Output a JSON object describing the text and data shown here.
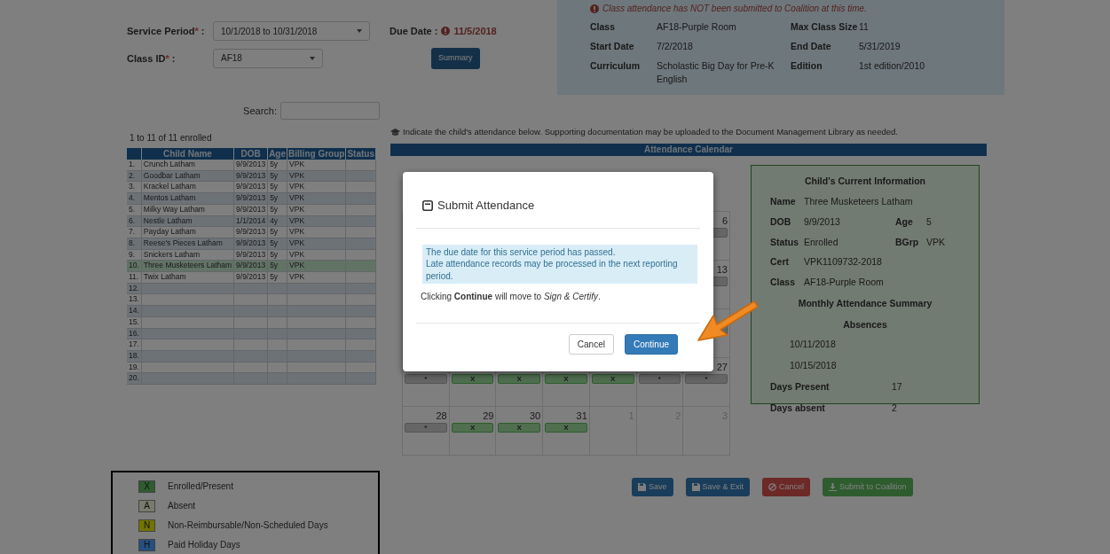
{
  "form": {
    "fields": [
      {
        "label": "Service Period",
        "required_mark": "*",
        "separator": ":",
        "value": "10/1/2018 to 10/31/2018"
      },
      {
        "label": "Class ID",
        "required_mark": "*",
        "separator": ":",
        "value": "AF18"
      }
    ],
    "due_date": {
      "label": "Due Date :",
      "value": "11/5/2018"
    },
    "summary_button": "Summary"
  },
  "class_info": {
    "notice": "Class attendance has NOT been submitted to Coalition at this time.",
    "rows": [
      {
        "label": "Class",
        "value": "AF18-Purple Room",
        "label2": "Max Class Size",
        "value2": "11"
      },
      {
        "label": "Start Date",
        "value": "7/2/2018",
        "label2": "End Date",
        "value2": "5/31/2019"
      },
      {
        "label": "Curriculum",
        "value": "Scholastic Big Day for Pre-K English",
        "label2": "Edition",
        "value2": "1st edition/2010"
      }
    ]
  },
  "search": {
    "label": "Search:"
  },
  "enrolled_count": "1 to 11 of 11 enrolled",
  "table": {
    "columns": [
      "",
      "Child Name",
      "DOB",
      "Age",
      "Billing Group",
      "Status"
    ],
    "rows": [
      {
        "num": "1.",
        "name": "Crunch Latham",
        "dob": "9/9/2013",
        "age": "5y",
        "group": "VPK",
        "selected": false
      },
      {
        "num": "2.",
        "name": "Goodbar Latham",
        "dob": "9/9/2013",
        "age": "5y",
        "group": "VPK",
        "selected": false
      },
      {
        "num": "3.",
        "name": "Krackel Latham",
        "dob": "9/9/2013",
        "age": "5y",
        "group": "VPK",
        "selected": false
      },
      {
        "num": "4.",
        "name": "Mentos Latham",
        "dob": "9/9/2013",
        "age": "5y",
        "group": "VPK",
        "selected": false
      },
      {
        "num": "5.",
        "name": "Milky Way Latham",
        "dob": "9/9/2013",
        "age": "5y",
        "group": "VPK",
        "selected": false
      },
      {
        "num": "6.",
        "name": "Nestle Latham",
        "dob": "1/1/2014",
        "age": "4y",
        "group": "VPK",
        "selected": false
      },
      {
        "num": "7.",
        "name": "Payday Latham",
        "dob": "9/9/2013",
        "age": "5y",
        "group": "VPK",
        "selected": false
      },
      {
        "num": "8.",
        "name": "Reese's Pieces Latham",
        "dob": "9/9/2013",
        "age": "5y",
        "group": "VPK",
        "selected": false
      },
      {
        "num": "9.",
        "name": "Snickers Latham",
        "dob": "9/9/2013",
        "age": "5y",
        "group": "VPK",
        "selected": false
      },
      {
        "num": "10.",
        "name": "Three Musketeers Latham",
        "dob": "9/9/2013",
        "age": "5y",
        "group": "VPK",
        "selected": true
      },
      {
        "num": "11.",
        "name": "Twix Latham",
        "dob": "9/9/2013",
        "age": "5y",
        "group": "VPK",
        "selected": false
      },
      {
        "num": "12.",
        "selected": false
      },
      {
        "num": "13.",
        "selected": false
      },
      {
        "num": "14.",
        "selected": false
      },
      {
        "num": "15.",
        "selected": false
      },
      {
        "num": "16.",
        "selected": false
      },
      {
        "num": "17.",
        "selected": false
      },
      {
        "num": "18.",
        "selected": false
      },
      {
        "num": "19.",
        "selected": false
      },
      {
        "num": "20.",
        "selected": false
      }
    ]
  },
  "instruction": "Indicate the child's attendance below. Supporting documentation may be uploaded to the Document Management Library as needed.",
  "calendar": {
    "title": "Attendance Calendar",
    "weeks": [
      [
        {
          "kind": "blank"
        },
        {
          "kind": "blank"
        },
        {
          "kind": "blank"
        },
        {
          "kind": "blank"
        },
        {
          "kind": "blank"
        },
        {
          "kind": "blank"
        },
        {
          "kind": "weekend",
          "day": "6"
        }
      ],
      [
        {
          "kind": "blank"
        },
        {
          "kind": "blank"
        },
        {
          "kind": "blank"
        },
        {
          "kind": "blank"
        },
        {
          "kind": "blank"
        },
        {
          "kind": "blank"
        },
        {
          "kind": "weekend",
          "day": "13"
        }
      ],
      [
        {
          "kind": "blank"
        },
        {
          "kind": "blank"
        },
        {
          "kind": "blank"
        },
        {
          "kind": "blank"
        },
        {
          "kind": "blank"
        },
        {
          "kind": "blank"
        },
        {
          "kind": "weekend"
        }
      ],
      [
        {
          "kind": "weekend",
          "mark": "*"
        },
        {
          "kind": "present",
          "mark": "X"
        },
        {
          "kind": "present",
          "mark": "X"
        },
        {
          "kind": "present",
          "mark": "X"
        },
        {
          "kind": "present",
          "mark": "X"
        },
        {
          "kind": "weekend",
          "mark": "*"
        },
        {
          "kind": "weekend",
          "day": "27",
          "mark": "*"
        }
      ],
      [
        {
          "kind": "weekend",
          "day": "28",
          "mark": "*"
        },
        {
          "kind": "present",
          "day": "29",
          "mark": "X"
        },
        {
          "kind": "present",
          "day": "30",
          "mark": "X"
        },
        {
          "kind": "present",
          "day": "31",
          "mark": "X"
        },
        {
          "kind": "outside",
          "day": "1"
        },
        {
          "kind": "outside",
          "day": "2"
        },
        {
          "kind": "outside",
          "day": "3"
        }
      ]
    ]
  },
  "child_info": {
    "title": "Child's Current Information",
    "rows": [
      {
        "label": "Name",
        "value": "Three Musketeers Latham"
      },
      {
        "label": "DOB",
        "value": "9/9/2013",
        "label2": "Age",
        "value2": "5"
      },
      {
        "label": "Status",
        "value": "Enrolled",
        "label2": "BGrp",
        "value2": "VPK"
      },
      {
        "label": "Cert",
        "value": "VPK1109732-2018"
      },
      {
        "label": "Class",
        "value": "AF18-Purple Room"
      }
    ],
    "summary_title": "Monthly Attendance Summary",
    "absences_title": "Absences",
    "absences": [
      "10/11/2018",
      "10/15/2018"
    ],
    "totals": [
      {
        "label": "Days Present",
        "value": "17"
      },
      {
        "label": "Days absent",
        "value": "2"
      }
    ]
  },
  "legend": [
    {
      "code": "X",
      "label": "Enrolled/Present",
      "color": "#2e5c2e"
    },
    {
      "code": "A",
      "label": "Absent",
      "color": "#7a7a6e"
    },
    {
      "code": "N",
      "label": "Non-Reimbursable/Non-Scheduled Days",
      "color": "#737300"
    },
    {
      "code": "H",
      "label": "Paid Holiday Days",
      "color": "#255080"
    }
  ],
  "actions": [
    {
      "kind": "save",
      "label": "Save"
    },
    {
      "kind": "save-exit",
      "label": "Save & Exit"
    },
    {
      "kind": "cancel",
      "label": "Cancel"
    },
    {
      "kind": "submit",
      "label": "Submit to Coalition"
    }
  ],
  "modal": {
    "title": "Submit Attendance",
    "alert_lines": [
      "The due date for this service period has passed.",
      "Late attendance records may be processed in the next reporting period."
    ],
    "message": "Clicking **Continue** will move to *Sign & Certify*.",
    "buttons": [
      {
        "kind": "secondary",
        "label": "Cancel"
      },
      {
        "kind": "primary",
        "label": "Continue"
      }
    ]
  }
}
